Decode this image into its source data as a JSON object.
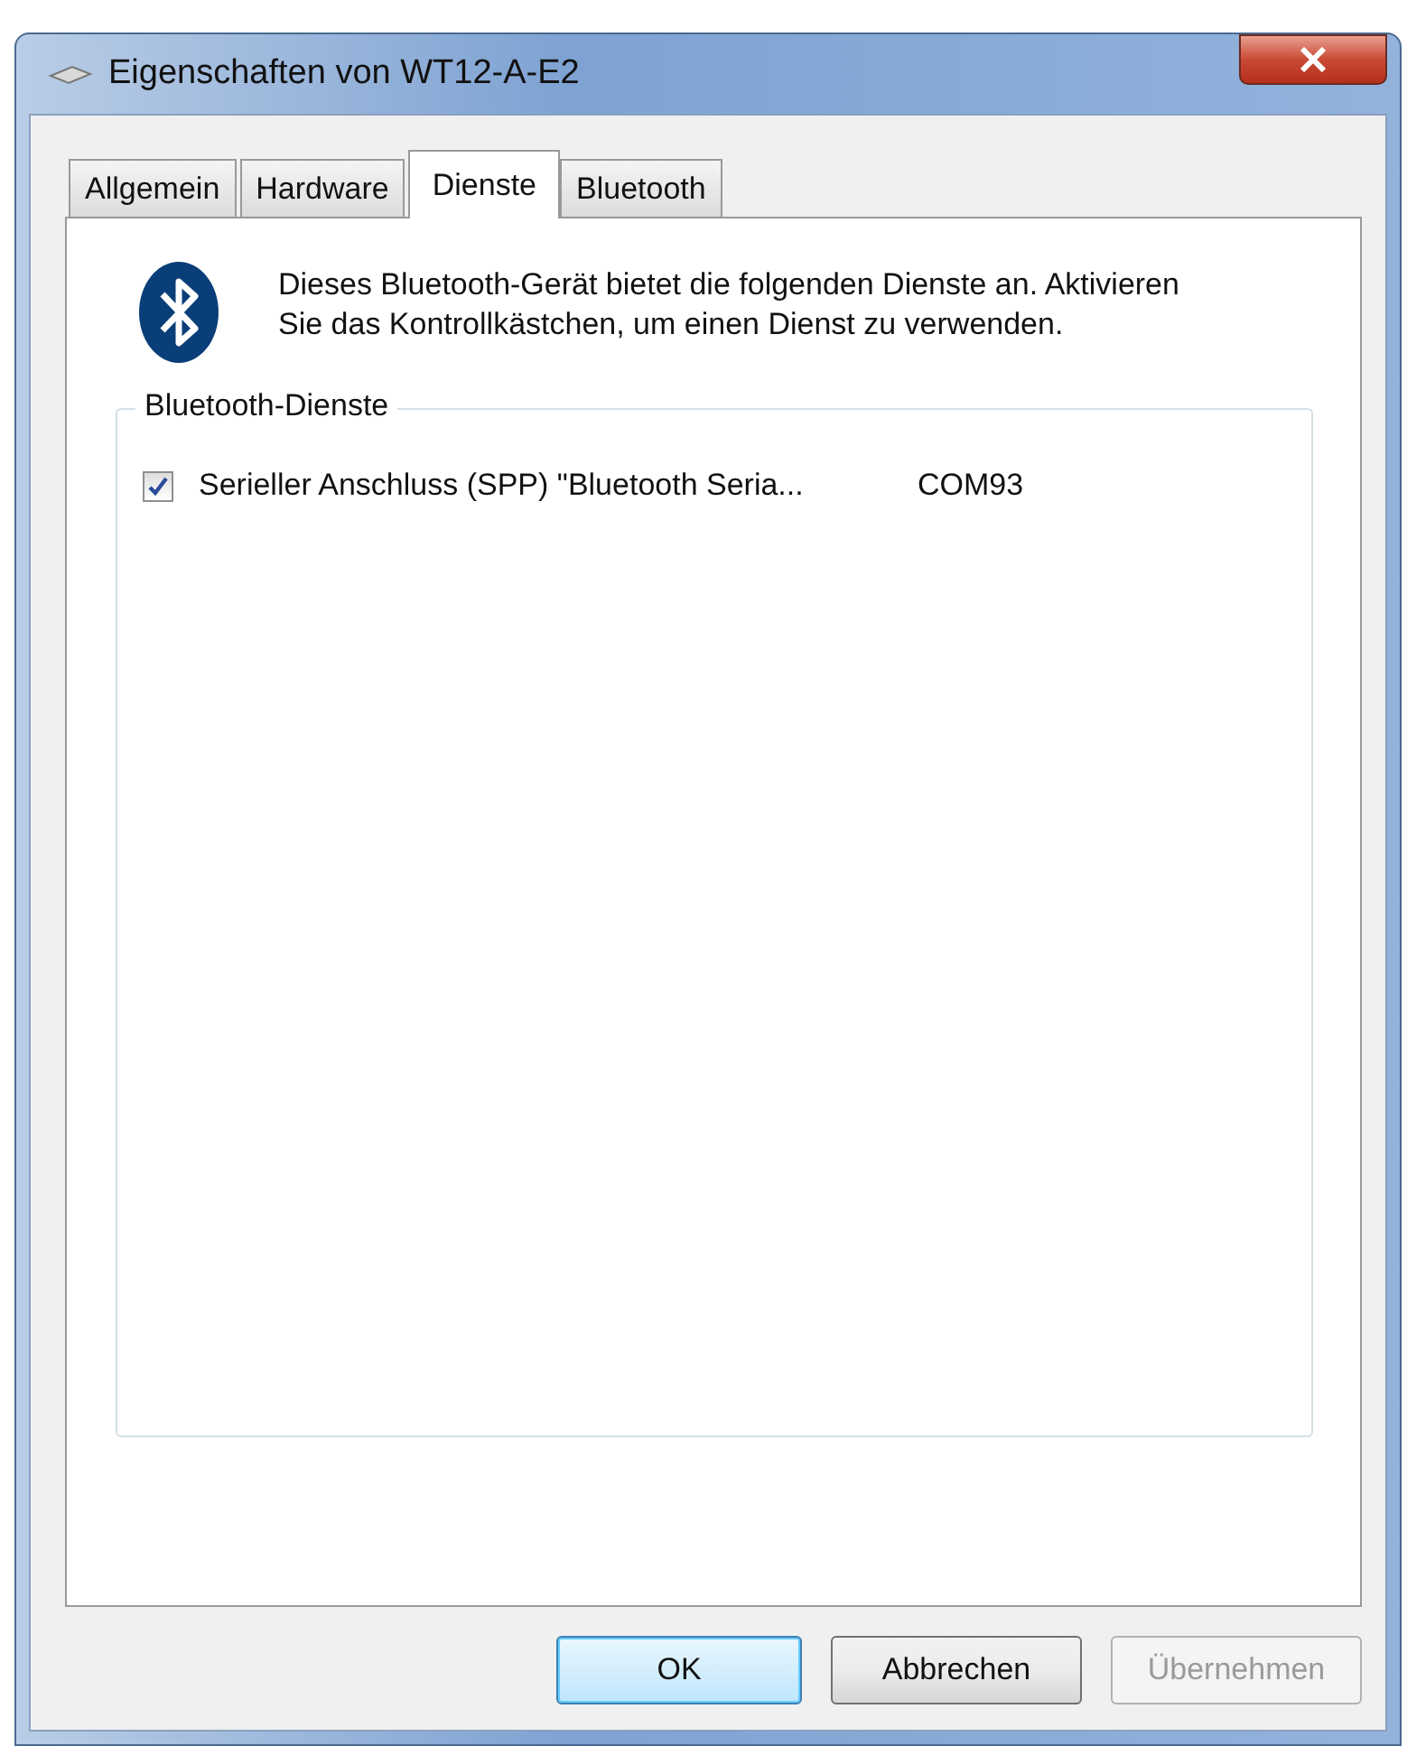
{
  "window": {
    "title": "Eigenschaften von WT12-A-E2"
  },
  "tabs": [
    {
      "label": "Allgemein",
      "selected": false
    },
    {
      "label": "Hardware",
      "selected": false
    },
    {
      "label": "Dienste",
      "selected": true
    },
    {
      "label": "Bluetooth",
      "selected": false
    }
  ],
  "intro": "Dieses Bluetooth-Gerät bietet die folgenden Dienste an. Aktivieren Sie das Kontrollkästchen, um einen Dienst zu verwenden.",
  "services_group": {
    "title": "Bluetooth-Dienste",
    "items": [
      {
        "name": "Serieller Anschluss (SPP) \"Bluetooth Seria...",
        "port": "COM93",
        "checked": true
      }
    ]
  },
  "buttons": [
    {
      "label": "OK",
      "kind": "default",
      "disabled": false
    },
    {
      "label": "Abbrechen",
      "kind": "normal",
      "disabled": false
    },
    {
      "label": "Übernehmen",
      "kind": "normal",
      "disabled": true
    }
  ]
}
